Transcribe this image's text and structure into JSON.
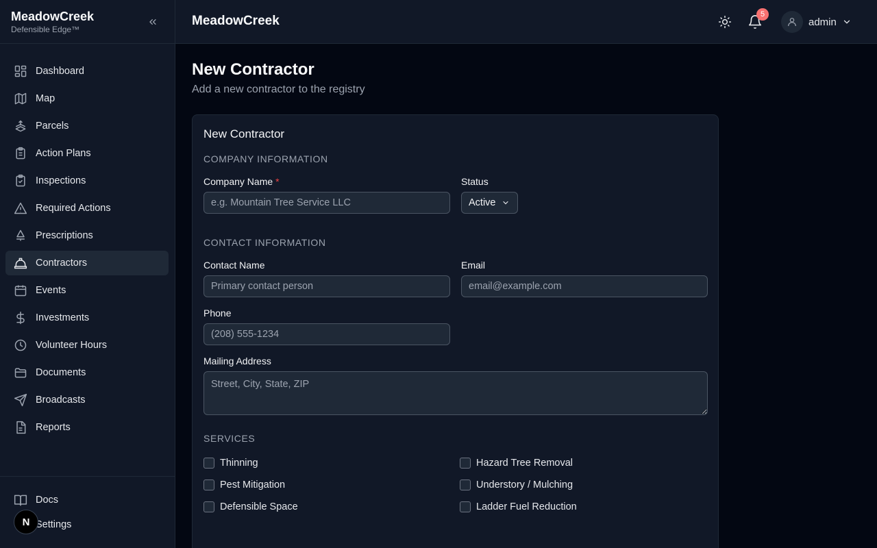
{
  "brand": {
    "name": "MeadowCreek",
    "tagline": "Defensible Edge™"
  },
  "sidebar": {
    "items": [
      {
        "label": "Dashboard",
        "icon": "dashboard-icon"
      },
      {
        "label": "Map",
        "icon": "map-icon"
      },
      {
        "label": "Parcels",
        "icon": "parcels-icon"
      },
      {
        "label": "Action Plans",
        "icon": "clipboard-icon"
      },
      {
        "label": "Inspections",
        "icon": "clipboard-check-icon"
      },
      {
        "label": "Required Actions",
        "icon": "warning-icon"
      },
      {
        "label": "Prescriptions",
        "icon": "tree-icon"
      },
      {
        "label": "Contractors",
        "icon": "hard-hat-icon",
        "active": true
      },
      {
        "label": "Events",
        "icon": "calendar-icon"
      },
      {
        "label": "Investments",
        "icon": "dollar-icon"
      },
      {
        "label": "Volunteer Hours",
        "icon": "clock-icon"
      },
      {
        "label": "Documents",
        "icon": "folder-icon"
      },
      {
        "label": "Broadcasts",
        "icon": "send-icon"
      },
      {
        "label": "Reports",
        "icon": "file-text-icon"
      }
    ],
    "bottom": [
      {
        "label": "Docs",
        "icon": "book-icon"
      },
      {
        "label": "Settings",
        "icon": "gear-icon"
      }
    ],
    "dev_badge": "N"
  },
  "topbar": {
    "title": "MeadowCreek",
    "notification_count": "5",
    "user": "admin"
  },
  "page": {
    "title": "New Contractor",
    "subtitle": "Add a new contractor to the registry"
  },
  "form": {
    "card_title": "New Contractor",
    "company_section": "COMPANY INFORMATION",
    "company_name_label": "Company Name",
    "company_name_required": "*",
    "company_name_placeholder": "e.g. Mountain Tree Service LLC",
    "status_label": "Status",
    "status_value": "Active",
    "contact_section": "CONTACT INFORMATION",
    "contact_name_label": "Contact Name",
    "contact_name_placeholder": "Primary contact person",
    "email_label": "Email",
    "email_placeholder": "email@example.com",
    "phone_label": "Phone",
    "phone_placeholder": "(208) 555-1234",
    "address_label": "Mailing Address",
    "address_placeholder": "Street, City, State, ZIP",
    "services_section": "SERVICES",
    "services": [
      "Thinning",
      "Hazard Tree Removal",
      "Pest Mitigation",
      "Understory / Mulching",
      "Defensible Space",
      "Ladder Fuel Reduction"
    ]
  },
  "colors": {
    "accent_red": "#ef4444",
    "badge_red": "#f87171",
    "sidebar_bg": "#111827",
    "page_bg": "#030712"
  }
}
